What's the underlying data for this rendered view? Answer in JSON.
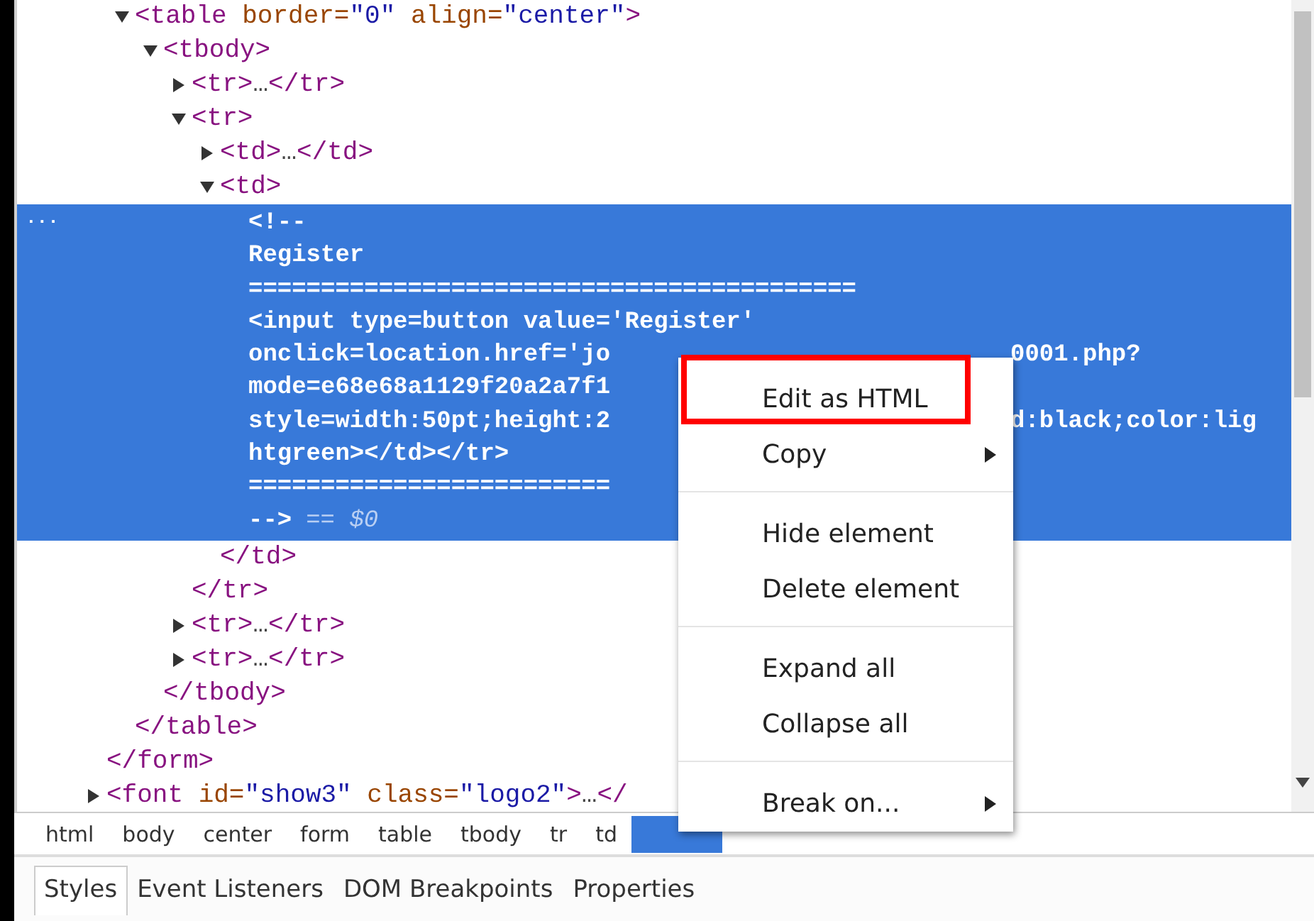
{
  "dom_tree": {
    "nodes": [
      {
        "close": "</form>",
        "children": [
          {
            "open": "<table border=\"0\" align=\"center\">",
            "expanded": true,
            "close": "</table>",
            "children": [
              {
                "open": "<tbody>",
                "expanded": true,
                "close": "</tbody>",
                "children": [
                  {
                    "open": "<tr>…</tr>",
                    "expanded": false
                  },
                  {
                    "open": "<tr>",
                    "expanded": true,
                    "close": "</tr>",
                    "children": [
                      {
                        "open": "<td>…</td>",
                        "expanded": false
                      },
                      {
                        "open": "<td>",
                        "expanded": true,
                        "close": "</td>",
                        "children": [
                          {
                            "kind": "comment",
                            "selected": true,
                            "gutter": "...",
                            "console_ref": "== $0",
                            "lines": [
                              {
                                "text": "<!--"
                              },
                              {
                                "text": "Register"
                              },
                              {
                                "text": "=========================================="
                              },
                              {
                                "text": "<input type=button value='Register'"
                              },
                              {
                                "text": "onclick=location.href='jo",
                                "tail": "0001.php?"
                              },
                              {
                                "text": "mode=e68e68a1129f20a2a7f1"
                              },
                              {
                                "text": "style=width:50pt;height:2",
                                "tail": "d:black;color:lig"
                              },
                              {
                                "text": "htgreen></td></tr>"
                              },
                              {
                                "text": "========================="
                              },
                              {
                                "text": "-->"
                              }
                            ]
                          }
                        ]
                      }
                    ]
                  },
                  {
                    "open": "<tr>…</tr>",
                    "expanded": false
                  },
                  {
                    "open": "<tr>…</tr>",
                    "expanded": false
                  }
                ]
              }
            ]
          }
        ]
      },
      {
        "open": "<font id=\"show3\" class=\"logo2\">…</",
        "expanded": false
      }
    ]
  },
  "breadcrumbs": [
    {
      "text": "html",
      "selected": false
    },
    {
      "text": "body",
      "selected": false
    },
    {
      "text": "center",
      "selected": false
    },
    {
      "text": "form",
      "selected": false
    },
    {
      "text": "table",
      "selected": false
    },
    {
      "text": "tbody",
      "selected": false
    },
    {
      "text": "tr",
      "selected": false
    },
    {
      "text": "td",
      "selected": false
    },
    {
      "selected": true
    }
  ],
  "tabs": [
    {
      "label": "Styles",
      "selected": true
    },
    {
      "label": "Event Listeners",
      "selected": false
    },
    {
      "label": "DOM Breakpoints",
      "selected": false
    },
    {
      "label": "Properties",
      "selected": false
    }
  ],
  "context_menu": {
    "groups": [
      [
        {
          "label": "Edit as HTML",
          "submenu": false,
          "highlighted": true
        },
        {
          "label": "Copy",
          "submenu": true,
          "highlighted": false
        }
      ],
      [
        {
          "label": "Hide element",
          "submenu": false,
          "highlighted": false
        },
        {
          "label": "Delete element",
          "submenu": false,
          "highlighted": false
        }
      ],
      [
        {
          "label": "Expand all",
          "submenu": false,
          "highlighted": false
        },
        {
          "label": "Collapse all",
          "submenu": false,
          "highlighted": false
        }
      ],
      [
        {
          "label": "Break on...",
          "submenu": true,
          "highlighted": false
        }
      ]
    ]
  }
}
